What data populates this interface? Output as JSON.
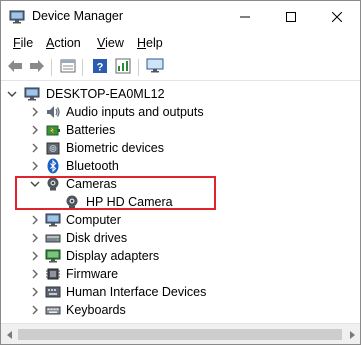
{
  "window": {
    "title": "Device Manager"
  },
  "menu": {
    "items": [
      {
        "underline": "F",
        "rest": "ile"
      },
      {
        "underline": "A",
        "rest": "ction"
      },
      {
        "underline": "V",
        "rest": "iew"
      },
      {
        "underline": "H",
        "rest": "elp"
      }
    ]
  },
  "toolbar": {
    "buttons": [
      "back-arrow-icon",
      "forward-arrow-icon",
      "properties-icon",
      "help-icon",
      "update-driver-icon",
      "monitor-icon"
    ]
  },
  "tree": {
    "root": "DESKTOP-EA0ML12",
    "items": [
      {
        "label": "Audio inputs and outputs",
        "icon": "speaker-icon",
        "expanded": false
      },
      {
        "label": "Batteries",
        "icon": "battery-icon",
        "expanded": false
      },
      {
        "label": "Biometric devices",
        "icon": "biometric-icon",
        "expanded": false
      },
      {
        "label": "Bluetooth",
        "icon": "bluetooth-icon",
        "expanded": false
      },
      {
        "label": "Cameras",
        "icon": "camera-icon",
        "expanded": true
      },
      {
        "label": "HP HD Camera",
        "icon": "camera-icon",
        "child": true
      },
      {
        "label": "Computer",
        "icon": "computer-icon",
        "expanded": false
      },
      {
        "label": "Disk drives",
        "icon": "disk-drive-icon",
        "expanded": false
      },
      {
        "label": "Display adapters",
        "icon": "display-adapter-icon",
        "expanded": false
      },
      {
        "label": "Firmware",
        "icon": "firmware-icon",
        "expanded": false
      },
      {
        "label": "Human Interface Devices",
        "icon": "hid-icon",
        "expanded": false
      },
      {
        "label": "Keyboards",
        "icon": "keyboard-icon",
        "expanded": false
      }
    ]
  },
  "colors": {
    "highlight": "#e0232c",
    "accent": "#0078d7"
  }
}
